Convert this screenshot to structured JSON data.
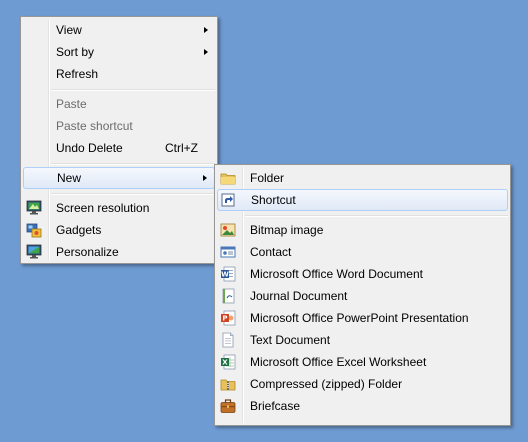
{
  "context_menu": {
    "group1": [
      {
        "label": "View",
        "submenu": true
      },
      {
        "label": "Sort by",
        "submenu": true
      },
      {
        "label": "Refresh"
      }
    ],
    "group2": [
      {
        "label": "Paste",
        "disabled": true
      },
      {
        "label": "Paste shortcut",
        "disabled": true
      },
      {
        "label": "Undo Delete",
        "shortcut": "Ctrl+Z"
      }
    ],
    "new_item": {
      "label": "New",
      "submenu": true,
      "highlighted": true
    },
    "group3": [
      {
        "label": "Screen resolution",
        "icon": "screen-resolution-icon"
      },
      {
        "label": "Gadgets",
        "icon": "gadgets-icon"
      },
      {
        "label": "Personalize",
        "icon": "personalize-icon"
      }
    ]
  },
  "new_submenu": {
    "group1": [
      {
        "label": "Folder",
        "icon": "folder-icon"
      },
      {
        "label": "Shortcut",
        "icon": "shortcut-icon",
        "highlighted": true
      }
    ],
    "group2": [
      {
        "label": "Bitmap image",
        "icon": "bitmap-image-icon"
      },
      {
        "label": "Contact",
        "icon": "contact-icon"
      },
      {
        "label": "Microsoft Office Word Document",
        "icon": "word-document-icon"
      },
      {
        "label": "Journal Document",
        "icon": "journal-document-icon"
      },
      {
        "label": "Microsoft Office PowerPoint Presentation",
        "icon": "powerpoint-presentation-icon"
      },
      {
        "label": "Text Document",
        "icon": "text-document-icon"
      },
      {
        "label": "Microsoft Office Excel Worksheet",
        "icon": "excel-worksheet-icon"
      },
      {
        "label": "Compressed (zipped) Folder",
        "icon": "zipped-folder-icon"
      },
      {
        "label": "Briefcase",
        "icon": "briefcase-icon"
      }
    ]
  },
  "colors": {
    "desktop": "#6f9bd3",
    "menu_bg": "#f0f0f0",
    "menu_border": "#979797",
    "highlight_border": "#aecff7",
    "disabled_text": "#6d6d6d"
  }
}
